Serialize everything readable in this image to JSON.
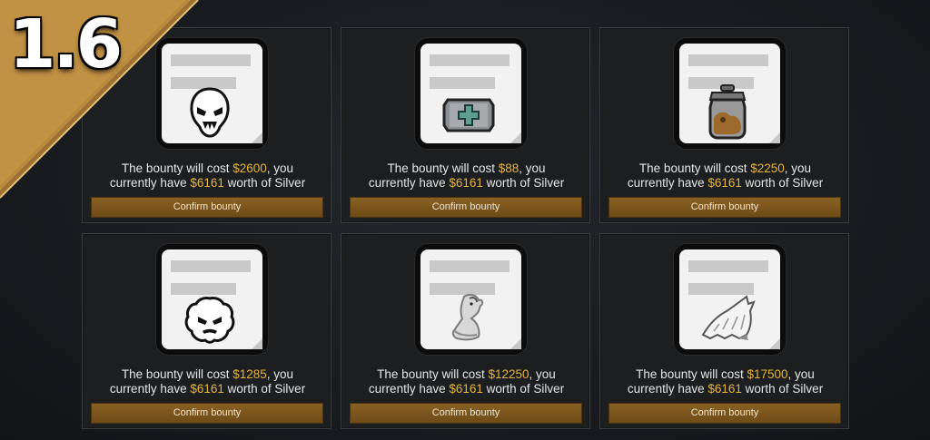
{
  "banner": {
    "version": "1.6",
    "color": "#b8893e"
  },
  "colors": {
    "money": "#e7b53b",
    "button": "#7a5420"
  },
  "bounties": [
    {
      "icon": "skull-mask-icon",
      "cost_prefix": "The bounty will cost ",
      "cost": "$2600",
      "cost_suffix": ", you",
      "have_prefix": "currently have ",
      "silver": "$6161",
      "have_suffix": " worth of Silver",
      "button": "Confirm bounty"
    },
    {
      "icon": "medkit-icon",
      "cost_prefix": "The bounty will cost ",
      "cost": "$88",
      "cost_suffix": ", you",
      "have_prefix": "currently have ",
      "silver": "$6161",
      "have_suffix": " worth of Silver",
      "button": "Confirm bounty"
    },
    {
      "icon": "jar-icon",
      "cost_prefix": "The bounty will cost ",
      "cost": "$2250",
      "cost_suffix": ", you",
      "have_prefix": "currently have ",
      "silver": "$6161",
      "have_suffix": " worth of Silver",
      "button": "Confirm bounty"
    },
    {
      "icon": "furry-face-icon",
      "cost_prefix": "The bounty will cost ",
      "cost": "$1285",
      "cost_suffix": ", you",
      "have_prefix": "currently have ",
      "silver": "$6161",
      "have_suffix": " worth of Silver",
      "button": "Confirm bounty"
    },
    {
      "icon": "goat-creature-icon",
      "cost_prefix": "The bounty will cost ",
      "cost": "$12250",
      "cost_suffix": ", you",
      "have_prefix": "currently have ",
      "silver": "$6161",
      "have_suffix": " worth of Silver",
      "button": "Confirm bounty"
    },
    {
      "icon": "fur-pelt-icon",
      "cost_prefix": "The bounty will cost ",
      "cost": "$17500",
      "cost_suffix": ", you",
      "have_prefix": "currently have ",
      "silver": "$6161",
      "have_suffix": " worth of Silver",
      "button": "Confirm bounty"
    }
  ]
}
